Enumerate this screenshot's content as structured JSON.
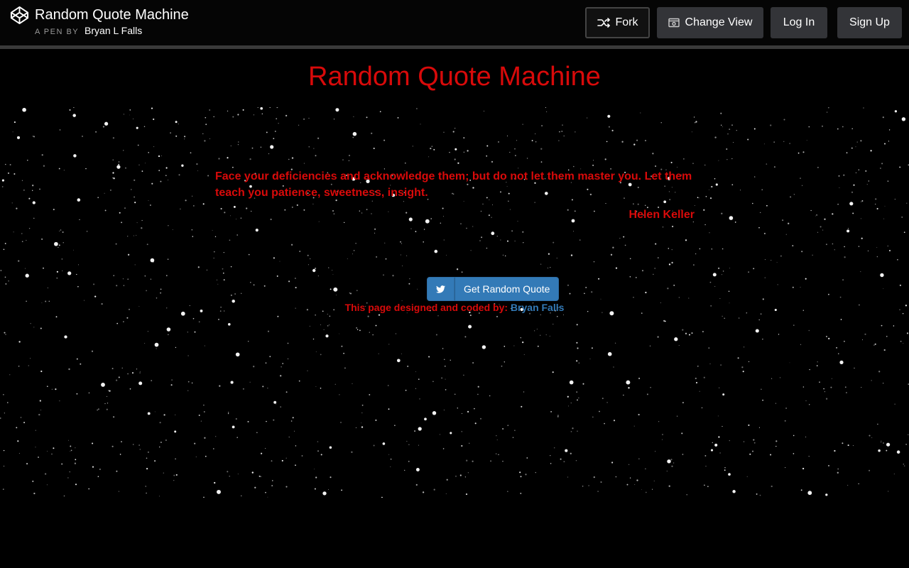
{
  "header": {
    "pen_title": "Random Quote Machine",
    "byline_prefix": "A PEN BY",
    "author_name": "Bryan L Falls",
    "buttons": {
      "fork": "Fork",
      "change_view": "Change View",
      "login": "Log In",
      "signup": "Sign Up"
    }
  },
  "page": {
    "heading": "Random Quote Machine",
    "quote": {
      "text": "Face your deficiencies and acknowledge them; but do not let them master you. Let them teach you patience, sweetness, insight.",
      "author": "Helen Keller"
    },
    "actions": {
      "tweet_icon": "twitter-icon",
      "new_quote_label": "Get Random Quote"
    },
    "credit": {
      "prefix": "This page designed and coded by:",
      "link_text": "Bryan Falls"
    }
  },
  "colors": {
    "accent_red": "#d80a0a",
    "button_blue": "#337ab7",
    "header_bg": "#050505",
    "header_button_bg": "#333438"
  }
}
